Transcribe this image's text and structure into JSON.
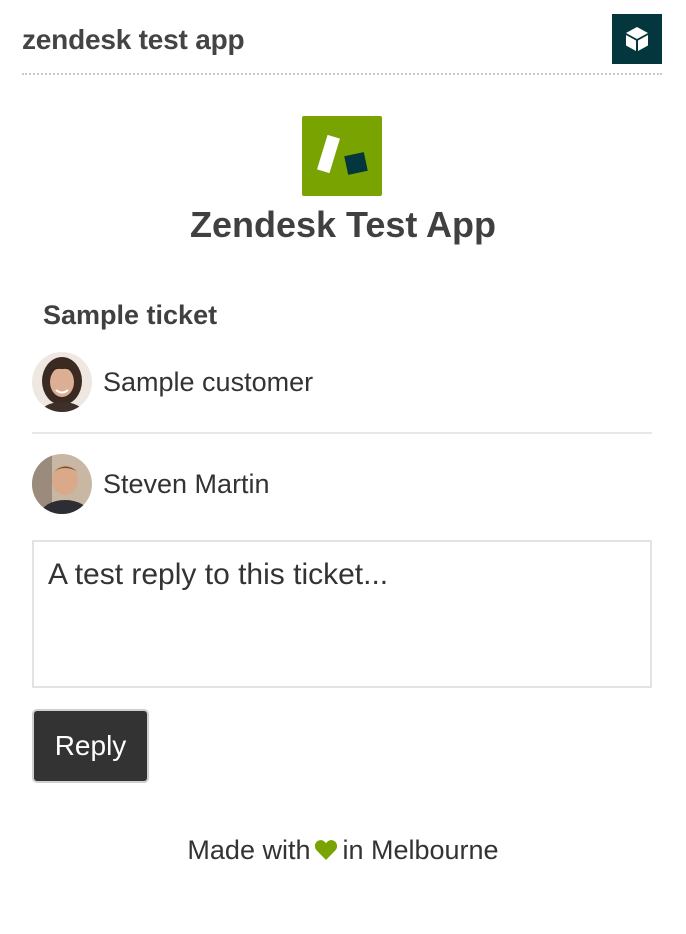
{
  "header": {
    "title": "zendesk test app",
    "app_icon": "box-icon"
  },
  "app": {
    "logo_icon": "zendesk-logo",
    "title": "Zendesk Test App",
    "brand_color": "#78a300",
    "dark_color": "#03363d"
  },
  "ticket": {
    "heading": "Sample ticket",
    "requester": {
      "name": "Sample customer",
      "avatar": "customer-avatar"
    },
    "assignee": {
      "name": "Steven Martin",
      "avatar": "agent-avatar"
    }
  },
  "reply": {
    "placeholder": "A test reply to this ticket...",
    "button_label": "Reply"
  },
  "footer": {
    "prefix": "Made with",
    "icon": "heart-icon",
    "suffix": "in Melbourne",
    "heart_color": "#78a300"
  }
}
